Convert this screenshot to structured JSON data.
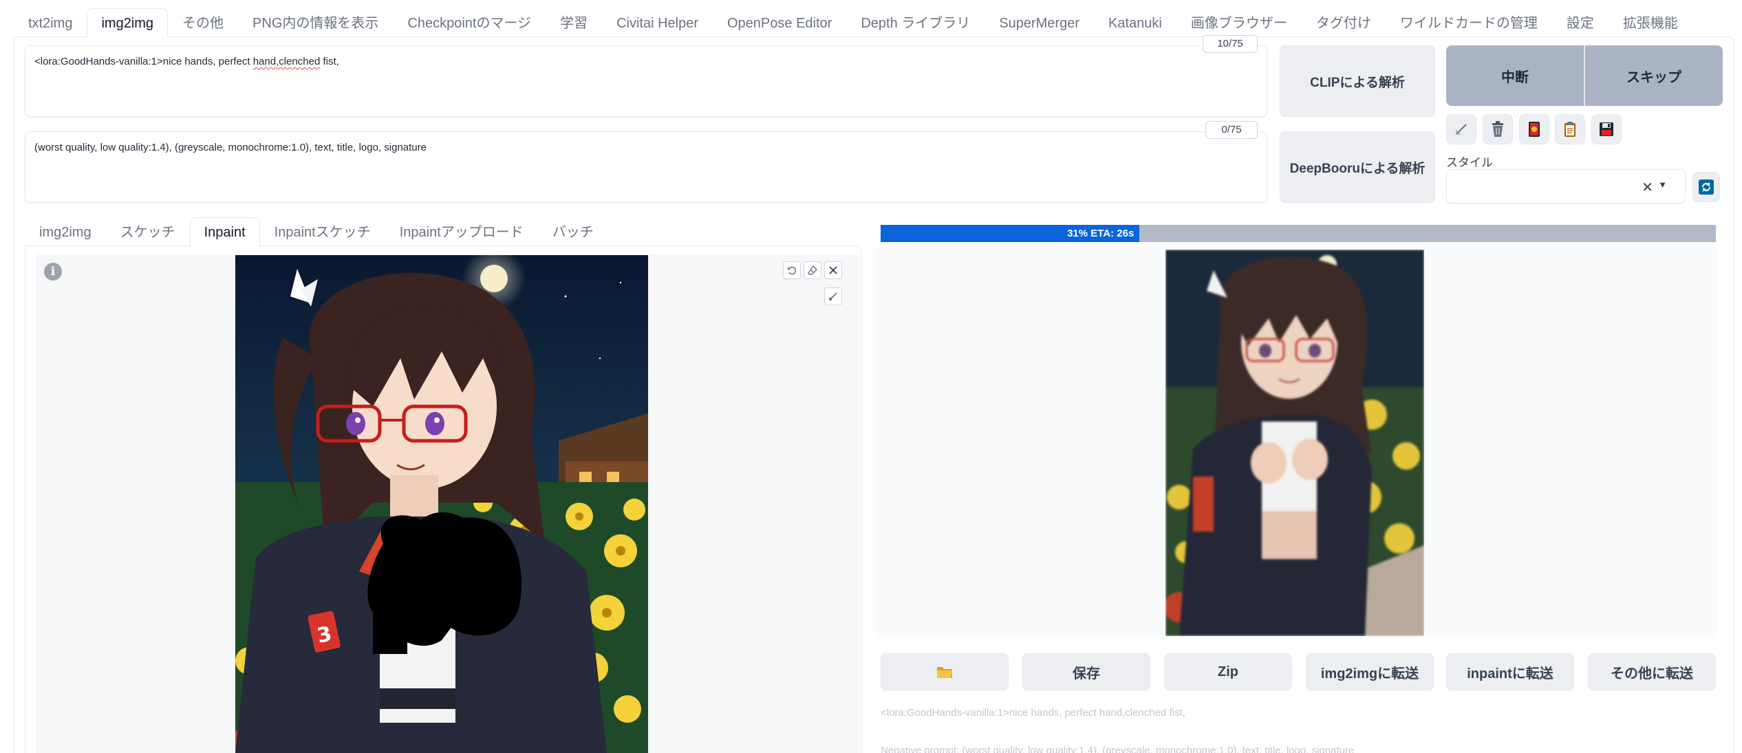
{
  "top_tabs": [
    {
      "label": "txt2img"
    },
    {
      "label": "img2img",
      "active": true
    },
    {
      "label": "その他"
    },
    {
      "label": "PNG内の情報を表示"
    },
    {
      "label": "Checkpointのマージ"
    },
    {
      "label": "学習"
    },
    {
      "label": "Civitai Helper"
    },
    {
      "label": "OpenPose Editor"
    },
    {
      "label": "Depth ライブラリ"
    },
    {
      "label": "SuperMerger"
    },
    {
      "label": "Katanuki"
    },
    {
      "label": "画像ブラウザー"
    },
    {
      "label": "タグ付け"
    },
    {
      "label": "ワイルドカードの管理"
    },
    {
      "label": "設定"
    },
    {
      "label": "拡張機能"
    }
  ],
  "prompt": {
    "pre": "<lora:GoodHands-vanilla:1>nice hands, perfect ",
    "spell1": "hand,clenched",
    "post": " fist,",
    "counter": "10/75"
  },
  "negative_prompt": {
    "text": "(worst quality, low quality:1.4), (greyscale, monochrome:1.0), text, title, logo, signature",
    "counter": "0/75"
  },
  "interrogate": {
    "clip_label": "CLIPによる解析",
    "deepbooru_label": "DeepBooruによる解析"
  },
  "controls": {
    "interrupt_label": "中断",
    "skip_label": "スキップ",
    "style_label": "スタイル",
    "style_clear": "✕",
    "style_chevron": "▼"
  },
  "sub_tabs": [
    {
      "label": "img2img"
    },
    {
      "label": "スケッチ"
    },
    {
      "label": "Inpaint",
      "active": true
    },
    {
      "label": "Inpaintスケッチ"
    },
    {
      "label": "Inpaintアップロード"
    },
    {
      "label": "バッチ"
    }
  ],
  "info_glyph": "i",
  "progress": {
    "fraction": 0.31,
    "label": "31% ETA: 26s",
    "fill_color": "#0a64dc",
    "track_color": "#b2bac8"
  },
  "output_buttons": {
    "folder_icon": "folder-icon",
    "save": "保存",
    "zip": "Zip",
    "to_img2img": "img2imgに転送",
    "to_inpaint": "inpaintに転送",
    "to_extras": "その他に転送"
  },
  "output_info": {
    "prompt": "<lora:GoodHands-vanilla:1>nice hands, perfect hand,clenched fist,",
    "negative": "Negative prompt: (worst quality, low quality:1.4), (greyscale, monochrome:1.0), text, title, logo, signature"
  }
}
